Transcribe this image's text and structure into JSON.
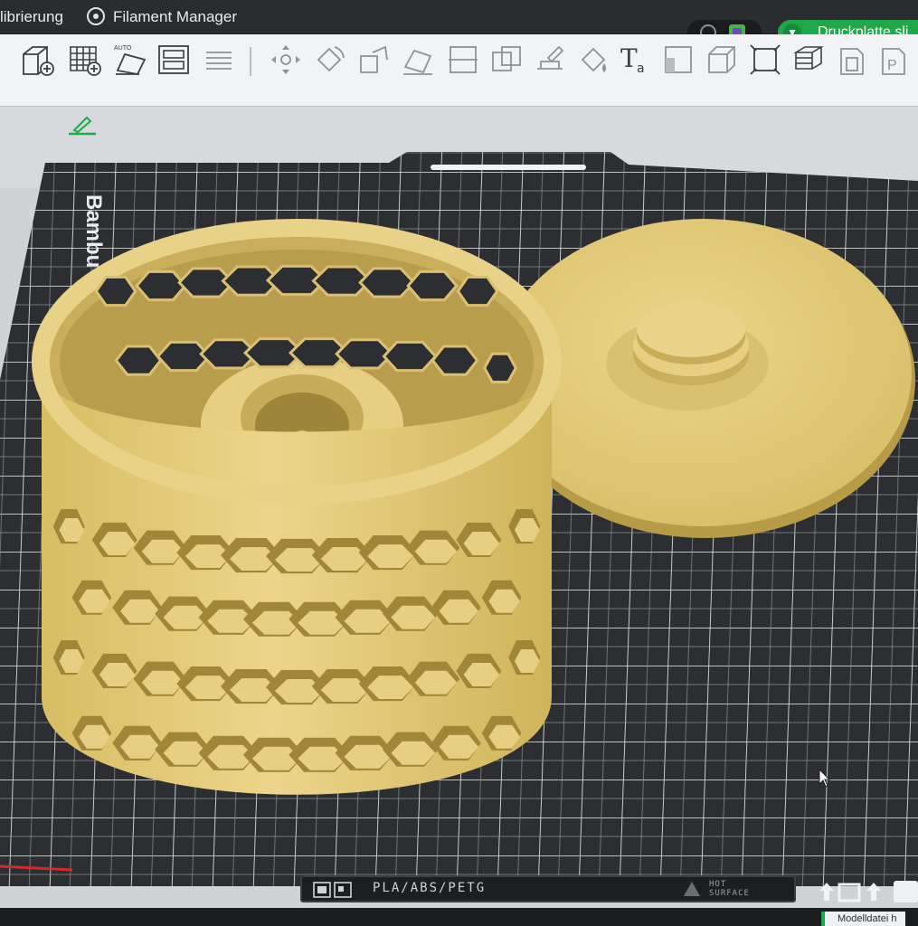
{
  "titlebar": {
    "tab_calibration_label": "librierung",
    "tab_filament_manager_label": "Filament Manager",
    "slice_button_label": "Druckplatte sli"
  },
  "plate": {
    "brand_label": "Bambu Tex"
  },
  "bottom_bar": {
    "filament_label": "PLA/ABS/PETG",
    "hot_surface_line1": "HOT",
    "hot_surface_line2": "SURFACE"
  },
  "status": {
    "text": "Modelldatei h"
  },
  "colors": {
    "model": "#e2c870",
    "plate": "#2c2e31",
    "grid": "#f2f3f4",
    "accent": "#1fa84a"
  },
  "toolbar_icons": [
    "add-object-icon",
    "add-plate-icon",
    "auto-orient-icon",
    "arrange-icon",
    "layers-icon",
    "move-icon",
    "rotate-icon",
    "scale-icon",
    "lay-on-face-icon",
    "cut-icon",
    "boolean-icon",
    "support-paint-icon",
    "color-paint-icon",
    "text-icon",
    "seam-icon",
    "variable-layer-icon",
    "measure-icon",
    "assembly-icon",
    "plate-view-icon",
    "preview-icon"
  ]
}
